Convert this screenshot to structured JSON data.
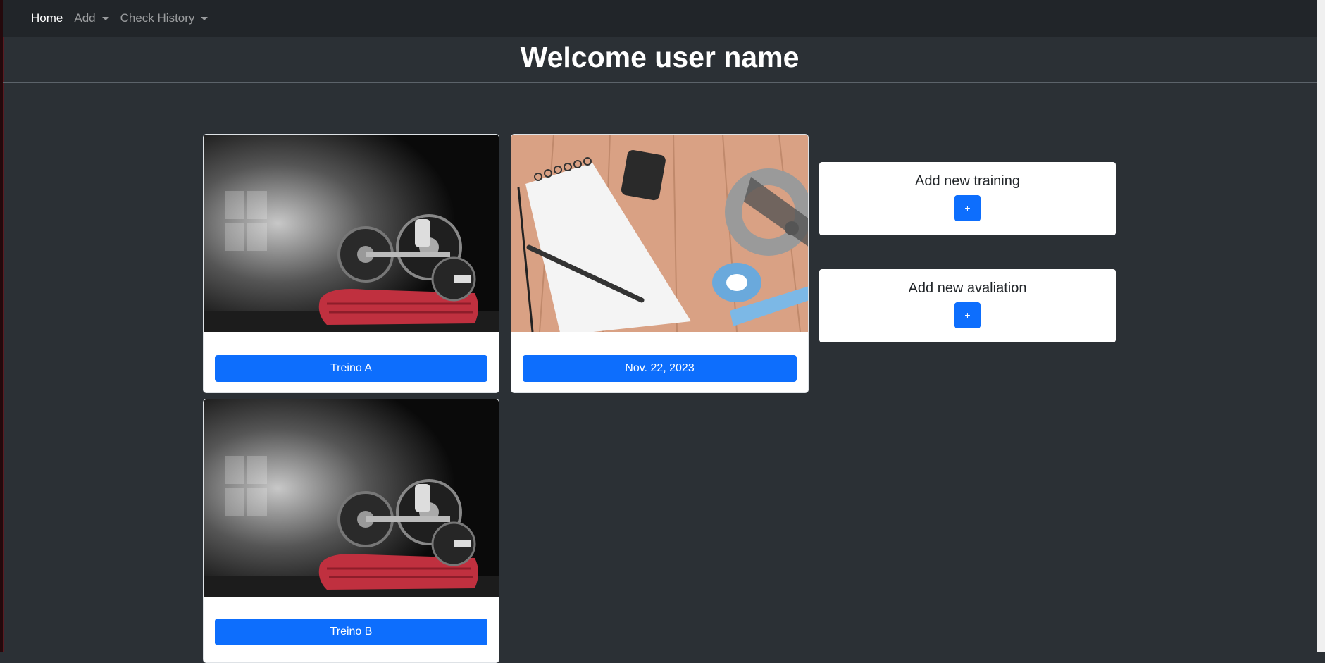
{
  "nav": {
    "home": "Home",
    "add": "Add",
    "history": "Check History"
  },
  "header": {
    "title": "Welcome user name"
  },
  "cards": [
    {
      "label": "Treino A",
      "image": "dumbbells-towel"
    },
    {
      "label": "Nov. 22, 2023",
      "image": "notebook-caliper"
    },
    {
      "label": "Treino B",
      "image": "dumbbells-towel"
    }
  ],
  "actions": {
    "training_title": "Add new training",
    "avaliation_title": "Add new avaliation",
    "plus": "+"
  },
  "colors": {
    "accent": "#0d6efd",
    "navbar": "#212529",
    "page": "#2b3035"
  }
}
